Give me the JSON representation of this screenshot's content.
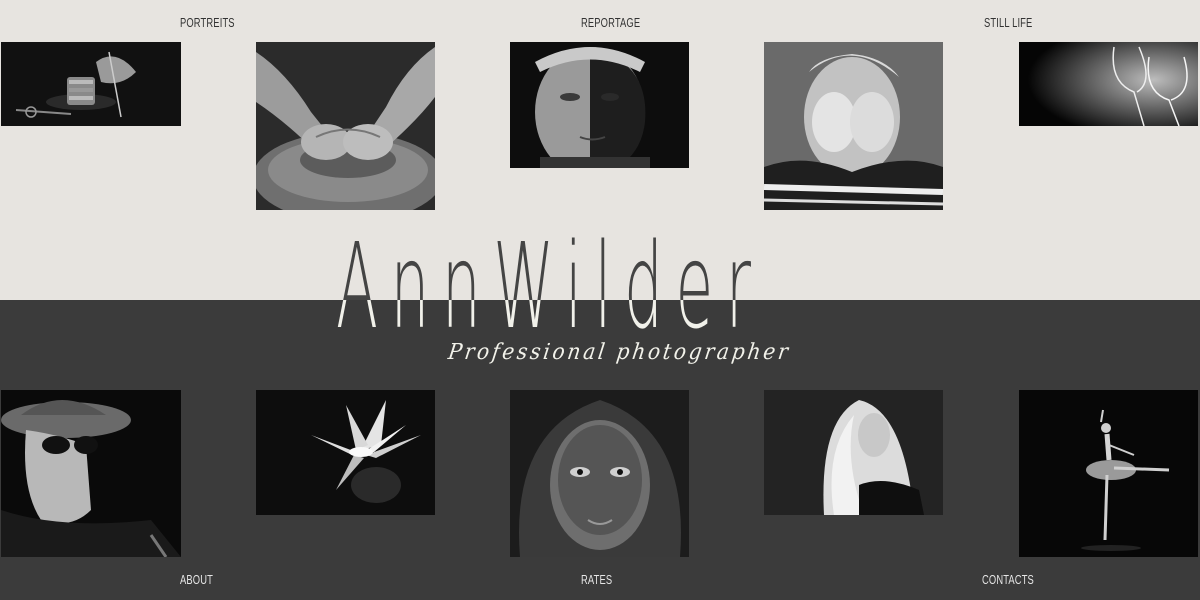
{
  "nav": {
    "top": [
      "PORTREITS",
      "REPORTAGE",
      "STILL LIFE"
    ],
    "bottom": [
      "ABOUT",
      "RATES",
      "CONTACTS"
    ]
  },
  "brand": {
    "name": "AnnWilder",
    "tagline": "Professional photographer"
  },
  "colors": {
    "top_background": "#e7e4e0",
    "bottom_background": "#3b3b3b",
    "brand_text": "#f1f1ea"
  },
  "photos": {
    "top": [
      "spools-still-life",
      "pottery-hands",
      "old-man-portrait",
      "child-covering-eyes",
      "wine-glasses"
    ],
    "bottom": [
      "woman-hat-sunglasses",
      "water-lily",
      "hooded-face",
      "blonde-woman",
      "ballerina"
    ]
  }
}
